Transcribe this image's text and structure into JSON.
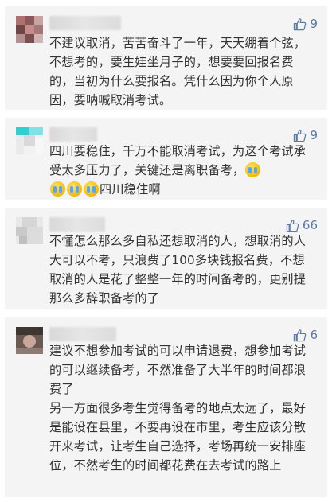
{
  "comments": [
    {
      "likes": "9",
      "paragraphs": [
        "不建议取消，苦苦奋斗了一年，天天绷着个弦，不想考的，要生娃坐月子的，想要要回报名费的，当初为什么要报名。凭什么因为你个人原因，要呐喊取消考试。"
      ]
    },
    {
      "likes": "9",
      "text_before": "四川要稳住，千万不能取消考试，为这个考试承受太多压力了，关键还是离职备考，",
      "text_after": "四川稳住啊",
      "emoji_name": "crying-face-icon"
    },
    {
      "likes": "66",
      "paragraphs": [
        "不懂怎么那么多自私还想取消的人，想取消的人大可以不考，只浪费了100多块钱报名费，不想取消的人是花了整整一年的时间备考的，更别提那么多辞职备考的了"
      ]
    },
    {
      "likes": "6",
      "paragraphs": [
        "建议不想参加考试的可以申请退费，想参加考试的可以继续备考，不然准备了大半年的时间都浪费了",
        "另一方面很多考生觉得备考的地点太远了，最好是能设在县里，不要再设在市里，考生应该分散开来考试，让考生自己选择，考场再统一安排座位，不然考生的时间都花费在去考试的路上"
      ]
    }
  ],
  "colors": {
    "card_bg": "#f4f4f4",
    "text": "#333333",
    "like_blue": "#5b7aa7"
  }
}
